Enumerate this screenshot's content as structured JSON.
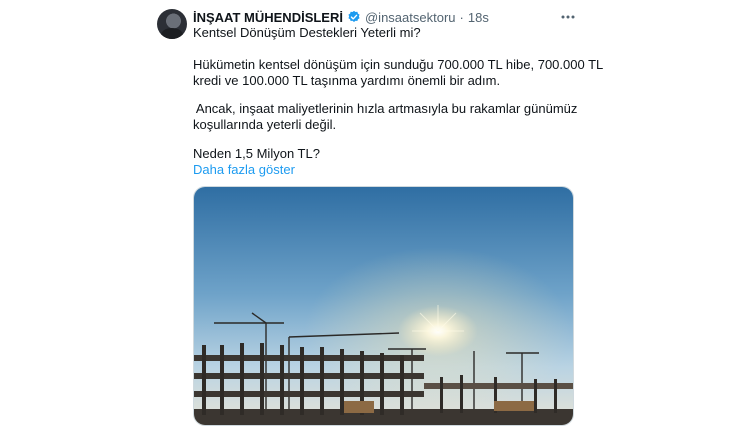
{
  "tweet": {
    "author_name": "İNŞAAT MÜHENDİSLERİ",
    "handle": "@insaatsektoru",
    "separator": "·",
    "time": "18s",
    "lines": [
      "Kentsel Dönüşüm Destekleri Yeterli mi?",
      "Hükümetin kentsel dönüşüm için sunduğu 700.000 TL hibe, 700.000 TL",
      "kredi ve 100.000 TL taşınma yardımı önemli bir adım.",
      " Ancak, inşaat maliyetlerinin hızla artmasıyla bu rakamlar günümüz",
      "koşullarında yeterli değil.",
      "Neden 1,5 Milyon TL?"
    ],
    "show_more": "Daha fazla göster",
    "icons": {
      "avatar": "profile-photo",
      "verified": "verified-badge-icon",
      "more": "more-horizontal-icon"
    },
    "colors": {
      "link": "#1d9bf0",
      "secondary_text": "#536471",
      "verified": "#1d9bf0"
    }
  }
}
